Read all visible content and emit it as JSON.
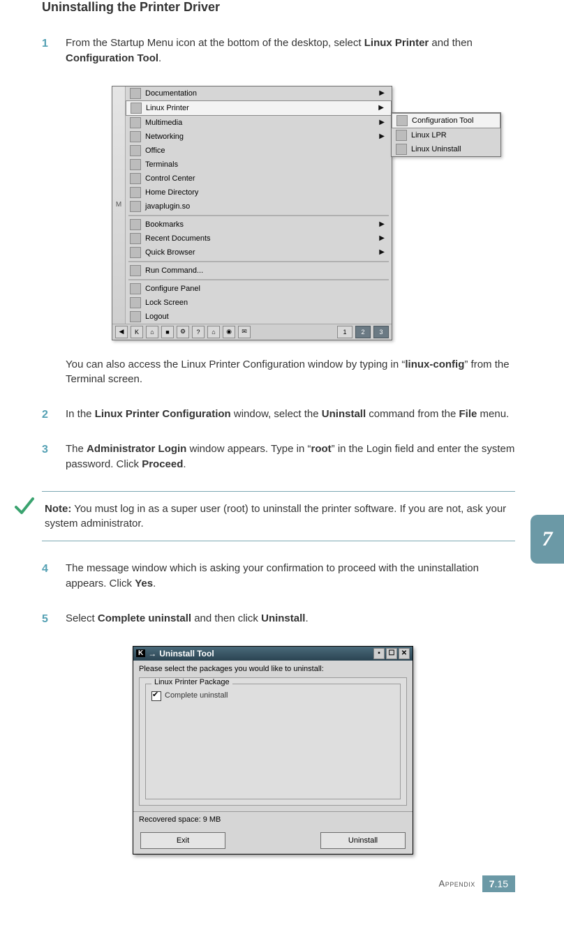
{
  "title": "Uninstalling the Printer Driver",
  "steps": {
    "s1": {
      "num": "1",
      "text_pre": "From the Startup Menu icon at the bottom of the desktop, select ",
      "b1": "Linux Printer",
      "mid": " and then ",
      "b2": "Configuration Tool",
      "text_post": "."
    },
    "s1b": {
      "text_pre": "You can also access the Linux Printer Configuration window by typing in “",
      "b1": "linux-config",
      "text_post": "” from the Terminal screen."
    },
    "s2": {
      "num": "2",
      "text_pre": "In the ",
      "b1": "Linux Printer Configuration",
      "mid": " window, select the ",
      "b2": "Uninstall",
      "mid2": " command from the ",
      "b3": "File",
      "text_post": " menu."
    },
    "s3": {
      "num": "3",
      "text_pre": "The ",
      "b1": "Administrator Login",
      "mid": " window appears. Type in “",
      "b2": "root",
      "mid2": "” in the Login field and enter the system password. Click ",
      "b3": "Proceed",
      "text_post": "."
    },
    "s4": {
      "num": "4",
      "text_pre": "The message window which is asking your confirmation to proceed with the uninstallation appears. Click ",
      "b1": "Yes",
      "text_post": "."
    },
    "s5": {
      "num": "5",
      "text_pre": "Select ",
      "b1": "Complete uninstall",
      "mid": " and then click ",
      "b2": "Uninstall",
      "text_post": "."
    }
  },
  "note": {
    "label": "Note:",
    "text": " You must log in as a super user (root) to uninstall the printer software. If you are not, ask your system administrator."
  },
  "menu": {
    "side_letter": "M",
    "items": [
      {
        "label": "Documentation",
        "arrow": true
      },
      {
        "label": "Linux Printer",
        "arrow": true,
        "sel": true
      },
      {
        "label": "Multimedia",
        "arrow": true
      },
      {
        "label": "Networking",
        "arrow": true
      },
      {
        "label": "Office",
        "arrow": false
      },
      {
        "label": "Terminals",
        "arrow": false
      },
      {
        "label": "Control Center",
        "arrow": false
      },
      {
        "label": "Home Directory",
        "arrow": false
      },
      {
        "label": "javaplugin.so",
        "arrow": false
      },
      {
        "label": "Bookmarks",
        "arrow": true
      },
      {
        "label": "Recent Documents",
        "arrow": true
      },
      {
        "label": "Quick Browser",
        "arrow": true
      },
      {
        "label": "Run Command...",
        "arrow": false
      },
      {
        "label": "Configure Panel",
        "arrow": false
      },
      {
        "label": "Lock Screen",
        "arrow": false
      },
      {
        "label": "Logout",
        "arrow": false
      }
    ],
    "submenu": [
      {
        "label": "Configuration Tool",
        "sel": true
      },
      {
        "label": "Linux LPR"
      },
      {
        "label": "Linux Uninstall"
      }
    ],
    "desktops": [
      "1",
      "2",
      "3"
    ]
  },
  "dialog": {
    "k": "K",
    "title": "Uninstall Tool",
    "instruction": "Please select the packages you would like to uninstall:",
    "fieldset_legend": "Linux Printer Package",
    "checkbox_label": "Complete uninstall",
    "status": "Recovered space:  9 MB",
    "btn_exit": "Exit",
    "btn_uninstall": "Uninstall"
  },
  "chapter_tab": "7",
  "footer": {
    "appendix": "Appendix",
    "chapter": "7",
    "dot": ".",
    "page": "15"
  }
}
